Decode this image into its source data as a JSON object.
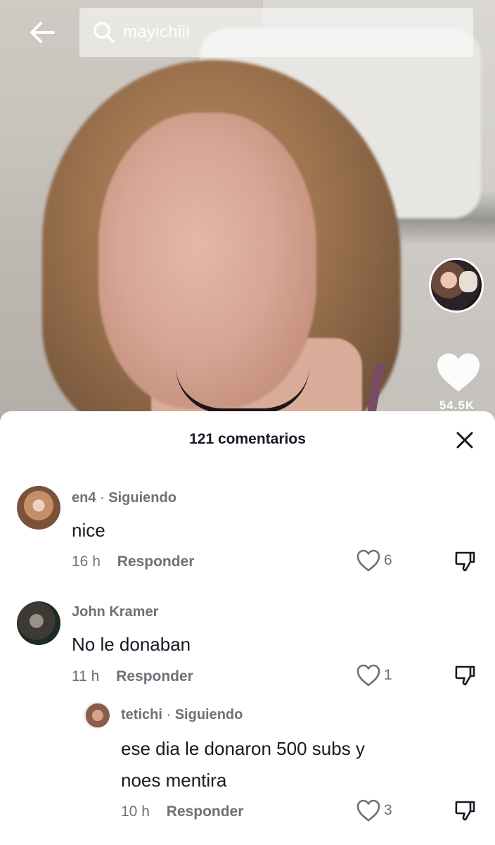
{
  "search": {
    "query": "mayichiii"
  },
  "video": {
    "like_count": "54.5K"
  },
  "comments_panel": {
    "title": "121 comentarios",
    "comments": [
      {
        "username": "en4",
        "status": "Siguiendo",
        "text": "nice",
        "time": "16 h",
        "reply_label": "Responder",
        "likes": "6"
      },
      {
        "username": "John Kramer",
        "text": "No le donaban",
        "time": "11 h",
        "reply_label": "Responder",
        "likes": "1"
      },
      {
        "username": "tetichi",
        "status": "Siguiendo",
        "text_line1": "ese dia le donaron 500 subs y",
        "text_line2": "noes mentira",
        "time": "10 h",
        "reply_label": "Responder",
        "likes": "3"
      }
    ]
  },
  "icons": {
    "back": "arrow-left-icon",
    "search": "search-icon",
    "like": "heart-icon",
    "close": "close-icon",
    "dislike": "thumbs-down-icon"
  }
}
